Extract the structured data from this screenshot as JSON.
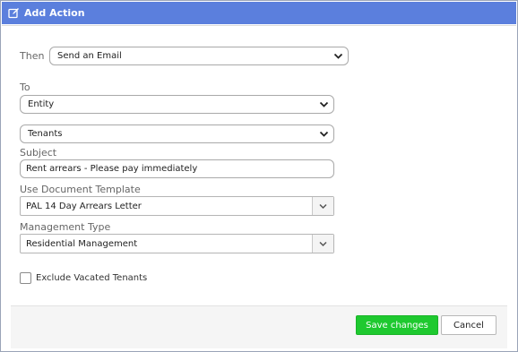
{
  "dialog": {
    "title": "Add Action"
  },
  "form": {
    "then_label": "Then",
    "then_value": "Send an Email",
    "to_label": "To",
    "to_value": "Entity",
    "entity_value": "Tenants",
    "subject_label": "Subject",
    "subject_value": "Rent arrears - Please pay immediately",
    "template_label": "Use Document Template",
    "template_value": "PAL 14 Day Arrears Letter",
    "mgmt_label": "Management Type",
    "mgmt_value": "Residential Management",
    "exclude_label": "Exclude Vacated Tenants",
    "exclude_checked": false
  },
  "footer": {
    "save_label": "Save changes",
    "cancel_label": "Cancel"
  },
  "colors": {
    "titlebar": "#5b7fdd",
    "save": "#1ec92f"
  },
  "icons": {
    "title": "edit-icon",
    "select": "chevron-down-icon"
  }
}
